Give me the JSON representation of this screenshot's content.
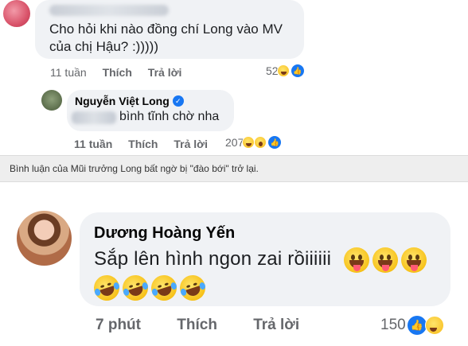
{
  "top_comment": {
    "text": "Cho hỏi khi nào đồng chí Long vào MV của chị Hậu? :)))))",
    "time": "11 tuần",
    "like_label": "Thích",
    "reply_label": "Trả lời",
    "reaction_count": "52",
    "reaction_icons": [
      "haha-icon",
      "like-icon"
    ]
  },
  "reply_comment": {
    "author": "Nguyễn Việt Long",
    "verified": true,
    "text": "bình tĩnh chờ nha",
    "time": "11 tuần",
    "like_label": "Thích",
    "reply_label": "Trả lời",
    "reaction_count": "207",
    "reaction_icons": [
      "haha-icon",
      "wow-icon",
      "like-icon"
    ]
  },
  "caption": "Bình luận của Mũi trưởng Long bất ngờ bị \"đào bới\" trở lại.",
  "bottom_comment": {
    "author": "Dương Hoàng Yến",
    "text": "Sắp lên hình ngon zai rồiiiiii",
    "time": "7 phút",
    "like_label": "Thích",
    "reply_label": "Trả lời",
    "reaction_count": "150",
    "reaction_icons": [
      "like-icon",
      "haha-icon"
    ],
    "emoji_inline": [
      "tongue-face-icon",
      "tongue-face-icon",
      "tongue-face-icon"
    ],
    "emoji_second_row": [
      "laughing-tears-icon",
      "laughing-tears-icon",
      "laughing-tears-icon",
      "laughing-tears-icon"
    ]
  },
  "colors": {
    "bubble_bg": "#f0f2f5",
    "meta_text": "#65676b",
    "like_blue": "#1877f2",
    "caption_bg": "#eeeeee"
  }
}
